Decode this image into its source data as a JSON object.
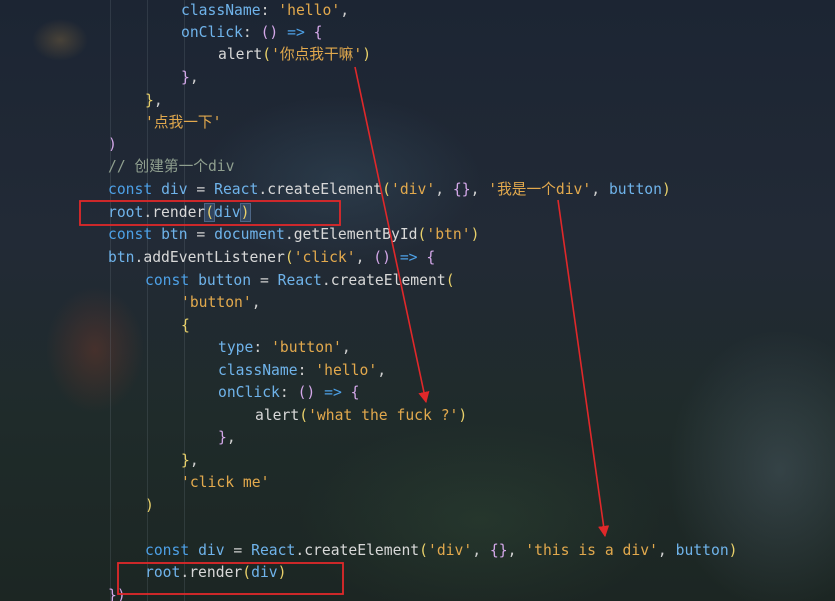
{
  "code": {
    "l1_prop": "className",
    "l1_val": "'hello'",
    "l2_prop": "onClick",
    "l3_fn": "alert",
    "l3_str": "'你点我干嘛'",
    "l5_str": "'点我一下'",
    "l7_comment": "// 创建第一个div",
    "l8_kw": "const",
    "l8_var": "div",
    "l8_react": "React",
    "l8_method": "createElement",
    "l8_s1": "'div'",
    "l8_s2": "'我是一个div'",
    "l8_arg": "button",
    "l9_root": "root",
    "l9_render": "render",
    "l9_arg": "div",
    "l10_kw": "const",
    "l10_var": "btn",
    "l10_doc": "document",
    "l10_method": "getElementById",
    "l10_str": "'btn'",
    "l11_obj": "btn",
    "l11_method": "addEventListener",
    "l11_str": "'click'",
    "l12_kw": "const",
    "l12_var": "button",
    "l12_react": "React",
    "l12_method": "createElement",
    "l13_str": "'button'",
    "l15_prop": "type",
    "l15_val": "'button'",
    "l16_prop": "className",
    "l16_val": "'hello'",
    "l17_prop": "onClick",
    "l18_fn": "alert",
    "l18_str": "'what the fuck ?'",
    "l21_str": "'click me'",
    "l24_kw": "const",
    "l24_var": "div",
    "l24_react": "React",
    "l24_method": "createElement",
    "l24_s1": "'div'",
    "l24_s2": "'this is a div'",
    "l24_arg": "button",
    "l25_root": "root",
    "l25_render": "render",
    "l25_arg": "div"
  },
  "annotation_color": "#e0282a"
}
